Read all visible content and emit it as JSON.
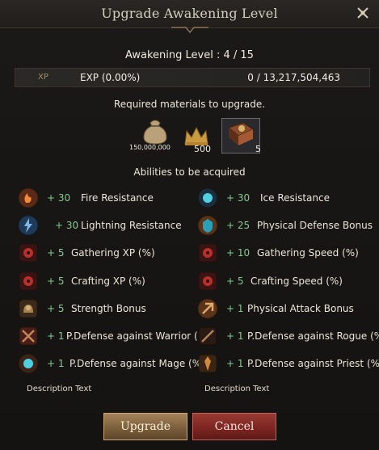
{
  "dialog": {
    "title": "Upgrade Awakening Level",
    "close_icon": "close-x-icon"
  },
  "awakening": {
    "level_text": "Awakening Level : 4 / 15"
  },
  "xp": {
    "tag": "XP",
    "label": "EXP (0.00%)",
    "value": "0 / 13,217,504,463",
    "progress": 0
  },
  "materials": {
    "heading": "Required materials to upgrade.",
    "items": [
      {
        "icon": "money-bag-icon",
        "qty": "150,000,000"
      },
      {
        "icon": "crown-icon",
        "qty": "500"
      },
      {
        "icon": "tome-icon",
        "qty": "5"
      }
    ]
  },
  "abilities": {
    "heading": "Abilities to be acquired",
    "left": [
      {
        "icon": "fire-icon",
        "plus": "+ 30",
        "name": "Fire Resistance"
      },
      {
        "icon": "lightning-icon",
        "plus": "+ 30",
        "name": "Lightning Resistance"
      },
      {
        "icon": "gathering-icon",
        "plus": "+ 5",
        "name": "Gathering XP (%)"
      },
      {
        "icon": "crafting-icon",
        "plus": "+ 5",
        "name": "Crafting XP (%)"
      },
      {
        "icon": "strength-icon",
        "plus": "+ 5",
        "name": "Strength Bonus"
      },
      {
        "icon": "warrior-defense-icon",
        "plus": "+ 1",
        "name": "P.Defense against Warrior (%)"
      },
      {
        "icon": "mage-defense-icon",
        "plus": "+ 1",
        "name": "P.Defense against Mage (%)"
      }
    ],
    "right": [
      {
        "icon": "ice-icon",
        "plus": "+ 30",
        "name": "Ice Resistance"
      },
      {
        "icon": "physical-defense-icon",
        "plus": "+ 25",
        "name": "Physical Defense Bonus"
      },
      {
        "icon": "gathering-speed-icon",
        "plus": "+ 10",
        "name": "Gathering Speed (%)"
      },
      {
        "icon": "crafting-speed-icon",
        "plus": "+ 5",
        "name": "Crafting Speed (%)"
      },
      {
        "icon": "physical-attack-icon",
        "plus": "+ 1",
        "name": "Physical Attack Bonus"
      },
      {
        "icon": "rogue-defense-icon",
        "plus": "+ 1",
        "name": "P.Defense against Rogue (%"
      },
      {
        "icon": "priest-defense-icon",
        "plus": "+ 1",
        "name": "P.Defense against Priest (%"
      }
    ]
  },
  "descriptions": {
    "left": "Description Text",
    "right": "Description Text"
  },
  "buttons": {
    "upgrade": "Upgrade",
    "cancel": "Cancel"
  },
  "colors": {
    "plus_green": "#7fcf8a",
    "upgrade_button": "#8a6a44",
    "cancel_button": "#8a2e29"
  }
}
